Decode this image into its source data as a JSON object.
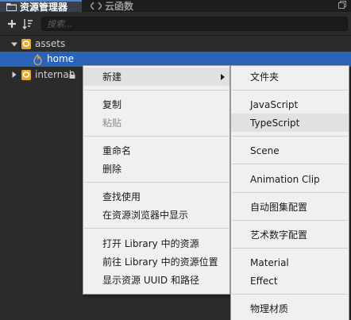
{
  "tabs": [
    {
      "label": "资源管理器",
      "icon": "folder-icon",
      "active": true
    },
    {
      "label": "云函数",
      "icon": "code-icon",
      "active": false
    }
  ],
  "toolbar": {
    "add_icon": "plus-icon",
    "sort_icon": "sort-icon",
    "search_placeholder": "搜索..."
  },
  "tree": [
    {
      "label": "assets",
      "icon": "db-icon",
      "expanded": true,
      "selected": false
    },
    {
      "label": "home",
      "icon": "flame-icon",
      "selected": true
    },
    {
      "label": "internal",
      "icon": "db-icon",
      "expanded": false,
      "locked": true,
      "selected": false
    }
  ],
  "context_menu": {
    "items": [
      {
        "label": "新建",
        "has_submenu": true,
        "hover": true
      },
      {
        "label": "复制"
      },
      {
        "label": "粘贴",
        "disabled": true
      },
      {
        "label": "重命名"
      },
      {
        "label": "删除"
      },
      {
        "label": "查找使用"
      },
      {
        "label": "在资源浏览器中显示"
      },
      {
        "label": "打开 Library 中的资源"
      },
      {
        "label": "前往 Library 中的资源位置"
      },
      {
        "label": "显示资源 UUID 和路径"
      }
    ]
  },
  "submenu": {
    "items": [
      {
        "label": "文件夹"
      },
      {
        "label": "JavaScript"
      },
      {
        "label": "TypeScript",
        "hover": true
      },
      {
        "label": "Scene"
      },
      {
        "label": "Animation Clip"
      },
      {
        "label": "自动图集配置"
      },
      {
        "label": "艺术数字配置"
      },
      {
        "label": "Material"
      },
      {
        "label": "Effect"
      },
      {
        "label": "物理材质"
      }
    ]
  },
  "colors": {
    "selection": "#2a64b8",
    "tab_accent": "#4a86d9",
    "asset_db": "#e8a92a"
  }
}
